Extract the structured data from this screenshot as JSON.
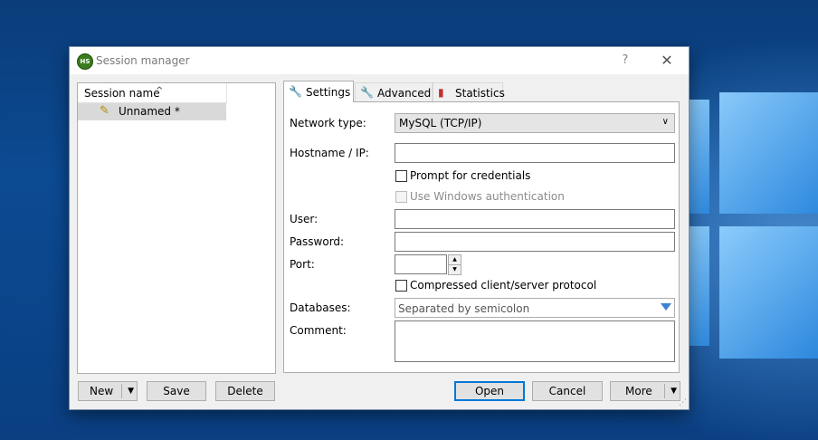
{
  "window": {
    "title": "Session manager",
    "app_icon_text": "HS",
    "help_glyph": "?",
    "close_glyph": "✕"
  },
  "session_tree": {
    "column_header": "Session name",
    "rows": [
      {
        "label": "Unnamed *"
      }
    ]
  },
  "left_buttons": {
    "new": "New",
    "save": "Save",
    "delete": "Delete"
  },
  "tabs": [
    {
      "label": "Settings",
      "icon": "wrench-icon",
      "active": true
    },
    {
      "label": "Advanced",
      "icon": "wrench-orange-icon",
      "active": false
    },
    {
      "label": "Statistics",
      "icon": "bar-chart-icon",
      "active": false
    }
  ],
  "settings": {
    "network_type_label": "Network type:",
    "network_type_value": "MySQL (TCP/IP)",
    "hostname_label": "Hostname / IP:",
    "hostname_value": "",
    "prompt_credentials_label": "Prompt for credentials",
    "prompt_credentials_checked": false,
    "windows_auth_label": "Use Windows authentication",
    "windows_auth_checked": false,
    "user_label": "User:",
    "user_value": "",
    "password_label": "Password:",
    "password_value": "",
    "port_label": "Port:",
    "port_value": "",
    "compressed_label": "Compressed client/server protocol",
    "compressed_checked": false,
    "databases_label": "Databases:",
    "databases_placeholder": "Separated by semicolon",
    "comment_label": "Comment:",
    "comment_value": ""
  },
  "bottom_buttons": {
    "open": "Open",
    "cancel": "Cancel",
    "more": "More"
  },
  "colors": {
    "focus_border": "#0078d7",
    "dropdown_arrow": "#3b82d0",
    "selected_row": "#d9d9d9"
  }
}
